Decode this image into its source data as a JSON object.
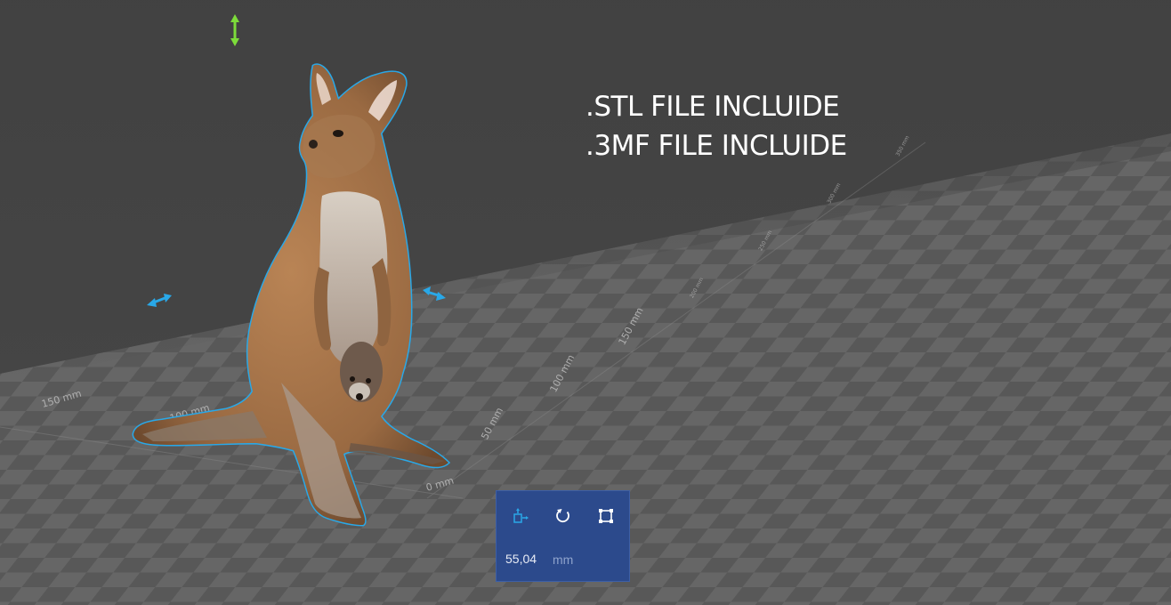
{
  "overlay": {
    "line1": ".STL FILE INCLUIDE",
    "line2": ".3MF FILE INCLUIDE"
  },
  "rulers": {
    "left_labels": [
      "150 mm",
      "100 mm",
      "50 mm",
      "0 mm"
    ],
    "right_labels": [
      "0 mm",
      "50 mm",
      "100 mm",
      "150 mm",
      "200 mm",
      "250 mm",
      "300 mm",
      "350 mm"
    ]
  },
  "model": {
    "name": "kangaroo",
    "selection_color": "#29a8e8"
  },
  "gizmos": {
    "vertical_color": "#7ddc3a",
    "horizontal_color": "#29a8e8"
  },
  "toolbox": {
    "tools": [
      "move-icon",
      "rotate-icon",
      "scale-icon"
    ],
    "size_value": "55,04",
    "size_unit": "mm",
    "background": "#2c4a8c",
    "icon_color": "#ffffff",
    "active_icon_color": "#29a8e8"
  }
}
